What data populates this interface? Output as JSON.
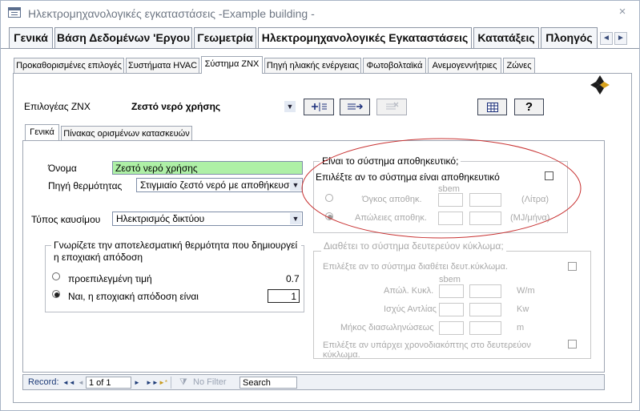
{
  "window": {
    "title": "Ηλεκτρομηχανολογικές εγκαταστάσεις -Example building -"
  },
  "main_tabs": [
    {
      "label": "Γενικά"
    },
    {
      "label": "Βάση Δεδομένων 'Εργου"
    },
    {
      "label": "Γεωμετρία"
    },
    {
      "label": "Ηλεκτρομηχανολογικές Εγκαταστάσεις"
    },
    {
      "label": "Κατατάξεις"
    },
    {
      "label": "Πλοηγός"
    }
  ],
  "sub_tabs": [
    {
      "label": "Προκαθορισμένες επιλογές"
    },
    {
      "label": "Συστήματα HVAC"
    },
    {
      "label": "Σύστημα ΖΝΧ"
    },
    {
      "label": "Πηγή ηλιακής ενέργειας"
    },
    {
      "label": "Φωτοβολταϊκά"
    },
    {
      "label": "Ανεμογεννήτριες"
    },
    {
      "label": "Ζώνες"
    }
  ],
  "selector": {
    "label": "Επιλογέας ΖΝΧ",
    "value": "Ζεστό νερό χρήσης"
  },
  "inner_tabs": [
    {
      "label": "Γενικά"
    },
    {
      "label": "Πίνακας ορισμένων κατασκευών"
    }
  ],
  "general": {
    "name_label": "Όνομα",
    "name_value": "Ζεστό νερό χρήσης",
    "heat_source_label": "Πηγή θερμότητας",
    "heat_source_value": "Στιγμιαίο ζεστό νερό με αποθήκευση",
    "fuel_label": "Τύπος καυσίμου",
    "fuel_value": "Ηλεκτρισμός δικτύου"
  },
  "efficiency": {
    "title": "Γνωρίζετε την αποτελεσματική θερμότητα που δημιουργεί η εποχιακή απόδοση",
    "default_label": "προεπιλεγμένη τιμή",
    "default_value": "0.7",
    "custom_label": "Ναι, η εποχιακή απόδοση είναι",
    "custom_value": "1"
  },
  "storage": {
    "title": "Είναι το σύστημα αποθηκευτικό;",
    "check_label": "Επιλέξτε αν το σύστημα είναι αποθηκευτικό",
    "sbem": "sbem",
    "volume_label": "Όγκος αποθηκ.",
    "volume_unit": "(Λίτρα)",
    "losses_label": "Απώλειες αποθηκ.",
    "losses_unit": "(MJ/μήνα)"
  },
  "secondary": {
    "title": "Διαθέτει το σύστημα δευτερεύον κύκλωμα;",
    "check_label": "Επιλέξτε αν το σύστημα διαθέτει δευτ.κύκλωμα.",
    "sbem": "sbem",
    "loss_label": "Απώλ. Κυκλ.",
    "loss_unit": "W/m",
    "pump_label": "Ισχύς Αντλίας",
    "pump_unit": "Kw",
    "length_label": "Μήκος διασωληνώσεως",
    "length_unit": "m",
    "timer_label": "Επιλέξτε αν υπάρχει χρονοδιακόπτης στο δευτερεύον κύκλωμα."
  },
  "record_bar": {
    "record_label": "Record:",
    "first": "◄◄",
    "prev": "◄",
    "position": "1 of 1",
    "next": "►",
    "last": "►►",
    "new": "►*",
    "filter": "No Filter",
    "search": "Search"
  },
  "colors": {
    "accent": "#3a4d7a",
    "field_green": "#aef0a6",
    "annotation_red": "#c83232"
  }
}
